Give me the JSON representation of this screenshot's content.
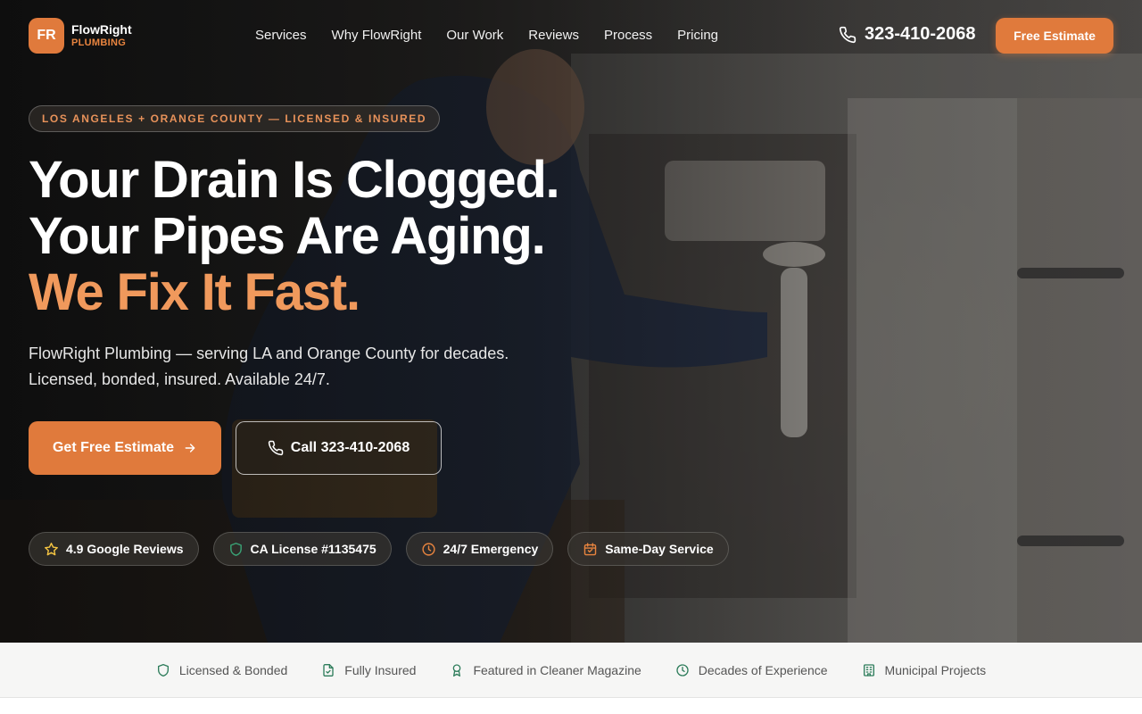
{
  "brand": {
    "mark": "FR",
    "name": "FlowRight",
    "sub": "PLUMBING"
  },
  "nav": {
    "links": [
      "Services",
      "Why FlowRight",
      "Our Work",
      "Reviews",
      "Process",
      "Pricing"
    ],
    "phone": "323-410-2068",
    "cta": "Free Estimate"
  },
  "hero": {
    "eyebrow": "LOS ANGELES + ORANGE COUNTY — LICENSED & INSURED",
    "headline_line1": "Your Drain Is Clogged.",
    "headline_line2": "Your Pipes Are Aging.",
    "headline_line3": "We Fix It Fast.",
    "sub_line1": "FlowRight Plumbing — serving LA and Orange County for decades.",
    "sub_line2": "Licensed, bonded, insured. Available 24/7.",
    "primary_cta": "Get Free Estimate",
    "secondary_cta": "Call 323-410-2068",
    "badges": [
      {
        "icon": "star-icon",
        "label": "4.9 Google Reviews"
      },
      {
        "icon": "shield-icon",
        "label": "CA License #1135475"
      },
      {
        "icon": "clock-icon",
        "label": "24/7 Emergency"
      },
      {
        "icon": "calendar-icon",
        "label": "Same-Day Service"
      }
    ]
  },
  "trust_bar": [
    {
      "icon": "shield-icon",
      "label": "Licensed & Bonded"
    },
    {
      "icon": "document-check-icon",
      "label": "Fully Insured"
    },
    {
      "icon": "award-icon",
      "label": "Featured in Cleaner Magazine"
    },
    {
      "icon": "clock-icon",
      "label": "Decades of Experience"
    },
    {
      "icon": "building-icon",
      "label": "Municipal Projects"
    }
  ],
  "colors": {
    "accent": "#e07a3c",
    "accent_text": "#f0995c",
    "trust_icon": "#2e7d5b"
  }
}
